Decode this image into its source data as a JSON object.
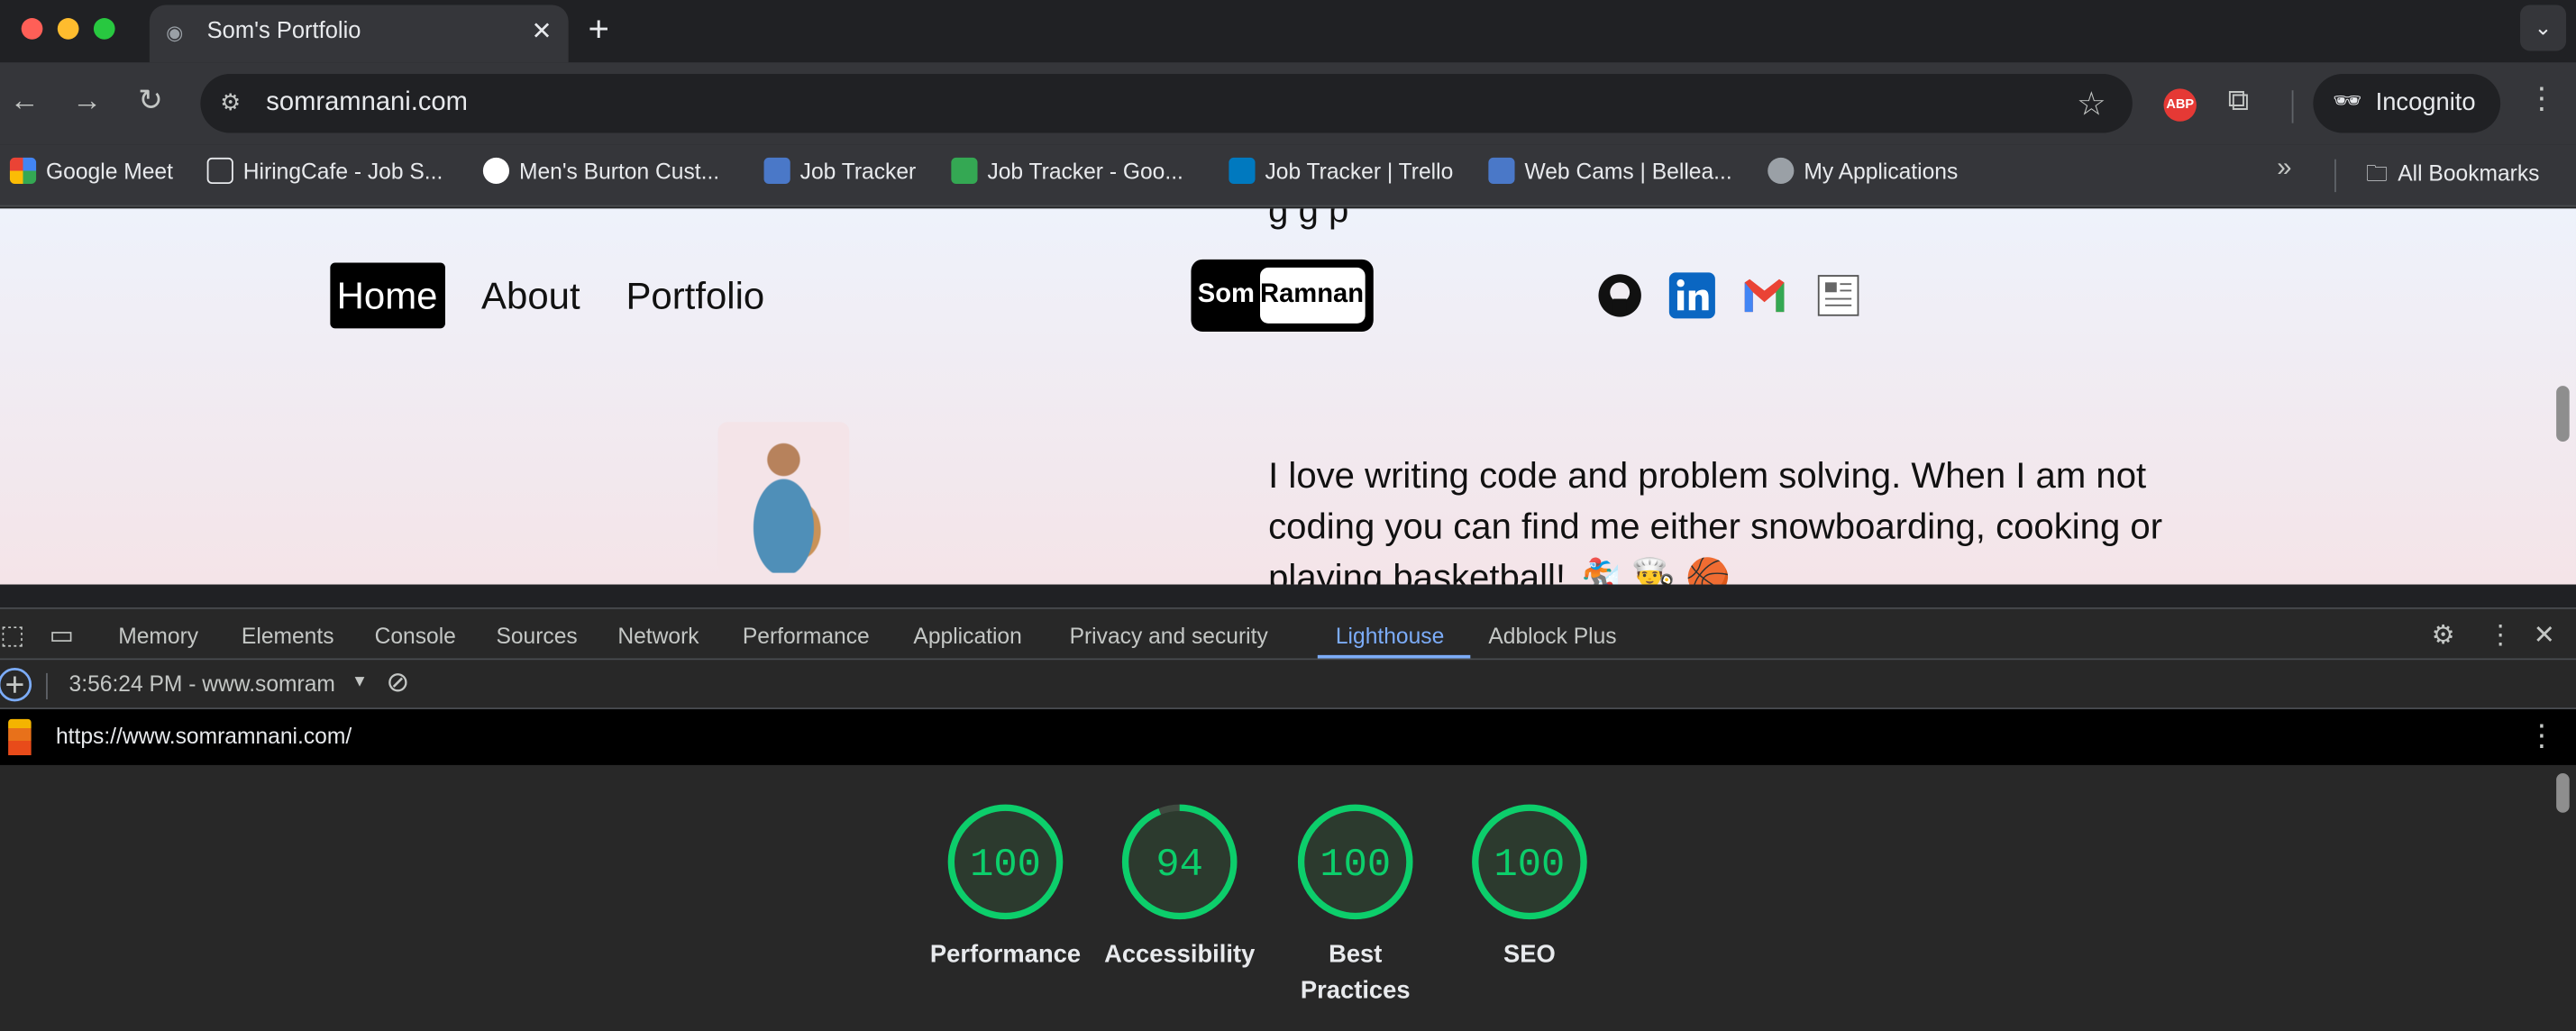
{
  "browser": {
    "tab_title": "Som's Portfolio",
    "url": "somramnani.com",
    "incognito_label": "Incognito",
    "abp_label": "ABP",
    "bookmarks": [
      {
        "label": "Google Meet",
        "icon": "google-meet-icon"
      },
      {
        "label": "HiringCafe - Job S...",
        "icon": "filter-icon"
      },
      {
        "label": "Men's Burton Cust...",
        "icon": "mountain-icon"
      },
      {
        "label": "Job Tracker",
        "icon": "tracker-icon"
      },
      {
        "label": "Job Tracker - Goo...",
        "icon": "sheets-icon"
      },
      {
        "label": "Job Tracker | Trello",
        "icon": "trello-icon"
      },
      {
        "label": "Web Cams | Bellea...",
        "icon": "webcam-icon"
      },
      {
        "label": "My Applications",
        "icon": "globe-icon"
      }
    ],
    "all_bookmarks": "All Bookmarks"
  },
  "site": {
    "nav": {
      "home": "Home",
      "about": "About",
      "portfolio": "Portfolio"
    },
    "logo": {
      "first": "Som",
      "last": "Ramnani"
    },
    "bio_cut": "g          g              p",
    "bio": "I love writing code and problem solving. When I am not coding you can find me either snowboarding, cooking or playing basketball! 🏂 👨‍🍳 🏀"
  },
  "devtools": {
    "tabs": [
      "Memory",
      "Elements",
      "Console",
      "Sources",
      "Network",
      "Performance",
      "Application",
      "Privacy and security",
      "Lighthouse",
      "Adblock Plus"
    ],
    "active_tab": "Lighthouse",
    "report_select": "3:56:24 PM - www.somram",
    "report_url": "https://www.somramnani.com/",
    "scores": [
      {
        "label": "Performance",
        "value": 100
      },
      {
        "label": "Accessibility",
        "value": 94
      },
      {
        "label": "Best Practices",
        "value": 100
      },
      {
        "label": "SEO",
        "value": 100
      }
    ],
    "score_color": "#0cce6b"
  }
}
